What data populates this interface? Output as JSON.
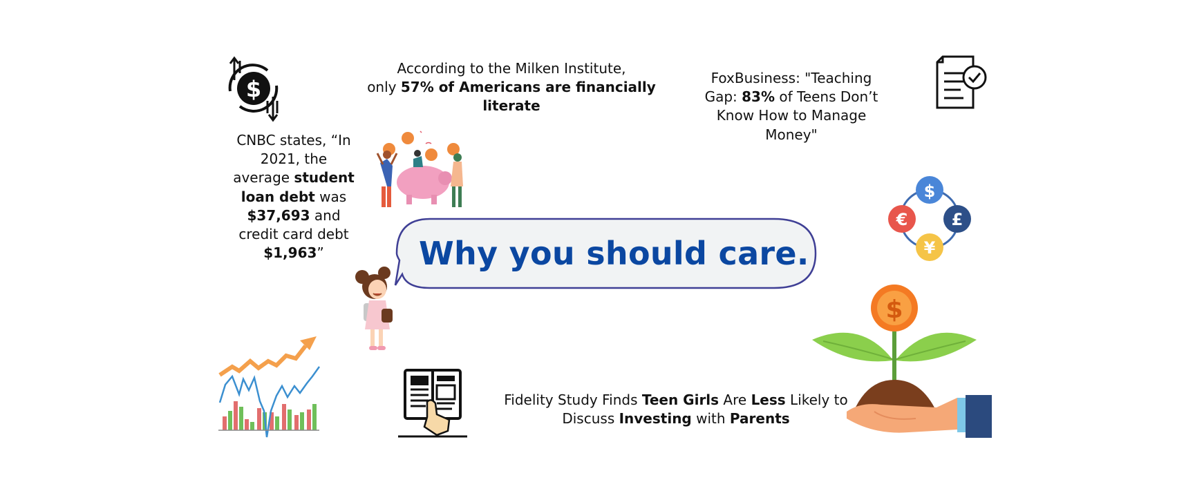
{
  "colors": {
    "headline": "#0b47a1",
    "bubble_fill": "#f1f3f4",
    "bubble_border": "#3f3f95",
    "ink": "#111111"
  },
  "headline": "Why you should care.",
  "cnbc": {
    "l1": "CNBC states, “In",
    "l2": "2021, the",
    "l3a": "average ",
    "l3b": "student",
    "l4a": "loan debt",
    "l4b": " was",
    "l5a": "$37,693",
    "l5b": " and",
    "l6": "credit card debt",
    "l7a": "$1,963",
    "l7b": "”"
  },
  "milken": {
    "l1": "According to the Milken Institute,",
    "l2a": "only ",
    "l2b": "57% of Americans are financially",
    "l3": "literate"
  },
  "foxbusiness": {
    "l1": "FoxBusiness: \"Teaching",
    "l2a": "Gap: ",
    "l2b": "83%",
    "l2c": " of Teens Don’t",
    "l3": "Know How to Manage",
    "l4": "Money\""
  },
  "fidelity": {
    "l1a": "Fidelity Study Finds ",
    "l1b": "Teen Girls",
    "l1c": " Are ",
    "l1d": "Less",
    "l1e": " Likely to",
    "l2a": "Discuss ",
    "l2b": "Investing",
    "l2c": " with ",
    "l2d": "Parents"
  },
  "icons": {
    "money_exchange": "dollar-exchange-icon",
    "document_check": "document-check-icon",
    "currency_cycle": "currency-cycle-icon",
    "piggy_bank_group": "piggy-bank-illustration",
    "girl_with_wallet": "girl-wallet-illustration",
    "stock_chart": "stock-chart-illustration",
    "book_reading": "book-reading-icon",
    "money_plant": "money-plant-hand-illustration"
  },
  "currency_symbols": {
    "dollar": "$",
    "euro": "€",
    "pound": "£",
    "yen": "¥"
  },
  "coin_symbol": "$"
}
